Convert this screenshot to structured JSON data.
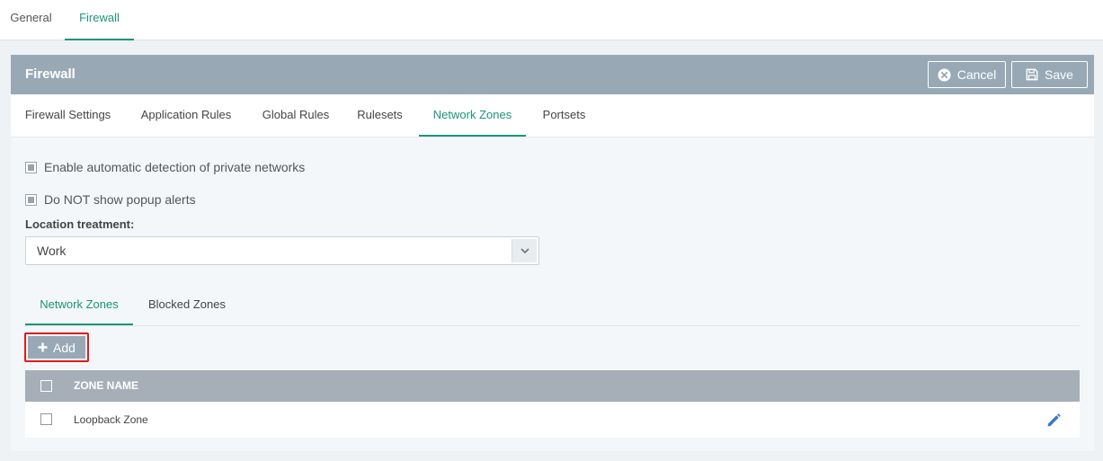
{
  "top_tabs": [
    {
      "label": "General",
      "active": false
    },
    {
      "label": "Firewall",
      "active": true
    }
  ],
  "panel": {
    "title": "Firewall",
    "cancel_label": "Cancel",
    "save_label": "Save"
  },
  "sub_tabs": [
    {
      "label": "Firewall Settings",
      "active": false
    },
    {
      "label": "Application Rules",
      "active": false
    },
    {
      "label": "Global Rules",
      "active": false
    },
    {
      "label": "Rulesets",
      "active": false
    },
    {
      "label": "Network Zones",
      "active": true
    },
    {
      "label": "Portsets",
      "active": false
    }
  ],
  "options": {
    "auto_detect_label": "Enable automatic detection of private networks",
    "no_popup_label": "Do NOT show popup alerts",
    "location_label": "Location treatment:",
    "location_value": "Work"
  },
  "zone_tabs": [
    {
      "label": "Network Zones",
      "active": true
    },
    {
      "label": "Blocked Zones",
      "active": false
    }
  ],
  "add_label": "Add",
  "table": {
    "header": "ZONE NAME",
    "rows": [
      {
        "name": "Loopback Zone"
      }
    ]
  },
  "colors": {
    "accent": "#1a9675",
    "header_bg": "#98a9b5",
    "highlight": "#e01b1b",
    "edit_icon": "#3a78c9"
  },
  "icons": {
    "cancel": "circle-x-icon",
    "save": "floppy-disk-icon",
    "add": "plus-icon",
    "edit": "pencil-icon",
    "dropdown": "chevron-down-icon"
  }
}
